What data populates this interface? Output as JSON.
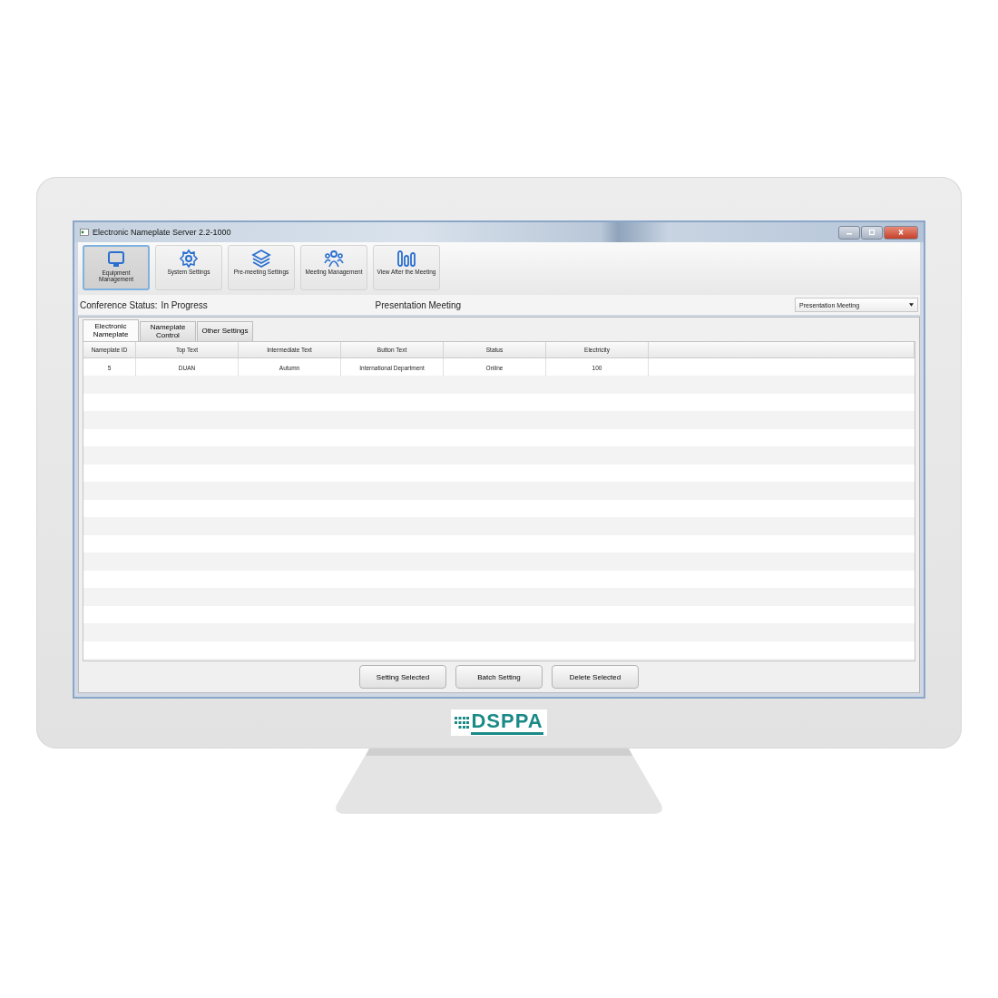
{
  "window": {
    "title": "Electronic Nameplate Server 2.2-1000"
  },
  "toolbar": [
    {
      "label": "Equipment Management",
      "selected": true
    },
    {
      "label": "System Settings",
      "selected": false
    },
    {
      "label": "Pre-meeting Settings",
      "selected": false
    },
    {
      "label": "Meeting Management",
      "selected": false
    },
    {
      "label": "View After the Meeting",
      "selected": false
    }
  ],
  "status_row": {
    "label": "Conference Status:",
    "value": "In Progress",
    "meeting": "Presentation Meeting",
    "dropdown": {
      "value": "Presentation Meeting"
    }
  },
  "tabs": [
    {
      "label": "Electronic Nameplate",
      "selected": true
    },
    {
      "label": "Nameplate Control",
      "selected": false
    },
    {
      "label": "Other Settings",
      "selected": false
    }
  ],
  "table": {
    "columns": [
      "Nameplate ID",
      "Top Text",
      "Intermediate Text",
      "Button Text",
      "Status",
      "Electricity"
    ],
    "rows": [
      [
        "5",
        "DUAN",
        "Autumn",
        "International Department",
        "Online",
        "100"
      ]
    ]
  },
  "buttons": [
    "Setting Selected",
    "Batch Setting",
    "Delete Selected"
  ],
  "logo": {
    "text": "DSPPA"
  }
}
